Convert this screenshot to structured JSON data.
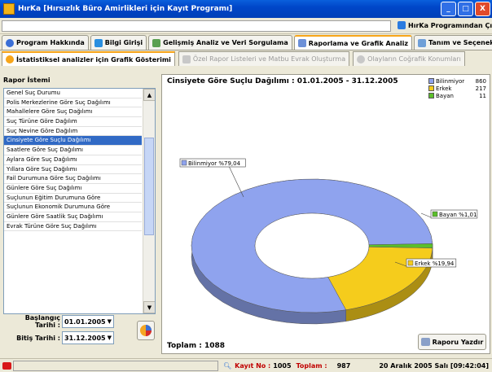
{
  "window": {
    "title": "HırKa [Hırsızlık Büro Amirlikleri için Kayıt Programı]",
    "btn_min": "_",
    "btn_max": "□",
    "btn_close": "X"
  },
  "topbar": {
    "programdan_cik": "HırKa Programından Çık"
  },
  "main_tabs": [
    {
      "label": "Program Hakkında"
    },
    {
      "label": "Bilgi Girişi"
    },
    {
      "label": "Gelişmiş Analiz ve Veri Sorgulama"
    },
    {
      "label": "Raporlama ve Grafik Analiz"
    },
    {
      "label": "Tanım ve Seçenekler"
    }
  ],
  "sub_tabs": [
    {
      "label": "İstatistiksel analizler için Grafik Gösterimi"
    },
    {
      "label": "Özel Rapor Listeleri ve Matbu Evrak Oluşturma"
    },
    {
      "label": "Olayların Coğrafik Konumları"
    }
  ],
  "left": {
    "header": "Rapor İstemi",
    "items": [
      "Genel Suç Durumu",
      "Polis Merkezlerine Göre Suç Dağılımı",
      "Mahallelere Göre Suç Dağılımı",
      "Suç Türüne Göre Dağılım",
      "Suç Nevine Göre Dağılım",
      "Cinsiyete Göre Suçlu Dağılımı",
      "Saatlere Göre Suç Dağılımı",
      "Aylara Göre Suç Dağılımı",
      "Yıllara Göre Suç Dağılımı",
      "Fail Durumuna Göre Suç Dağılımı",
      "Günlere Göre Suç Dağılımı",
      "Suçlunun Eğitim Durumuna Göre",
      "Suçlunun Ekonomik Durumuna Göre",
      "Günlere Göre Saatlik Suç Dağılımı",
      "Evrak Türüne Göre Suç Dağılımı"
    ],
    "selected_index": 5,
    "start_label": "Başlangıç Tarihi :",
    "start_value": "01.01.2005",
    "end_label": "Bitiş Tarihi :",
    "end_value": "31.12.2005"
  },
  "chart_data": {
    "type": "pie",
    "title": "Cinsiyete Göre Suçlu Dağılımı : 01.01.2005 - 31.12.2005",
    "categories": [
      "Bilinmiyor",
      "Erkek",
      "Bayan"
    ],
    "values": [
      860,
      217,
      11
    ],
    "slice_labels": [
      "Bilinmiyor %79,04",
      "Erkek %19,94",
      "Bayan %1,01"
    ],
    "legend_values": [
      "860",
      "217",
      "11"
    ],
    "colors": [
      "#8fa3ee",
      "#f5cc1c",
      "#5bbf2a"
    ],
    "legend_position": "top-right"
  },
  "chart_footer": {
    "total": "Toplam : 1088",
    "print_label": "Raporu Yazdır"
  },
  "statusbar": {
    "kayit_label": "Kayıt No :",
    "kayit_value": "1005",
    "toplam_label": "Toplam :",
    "toplam_value": "987",
    "datetime": "20 Aralık 2005 Salı [09:42:04]"
  }
}
